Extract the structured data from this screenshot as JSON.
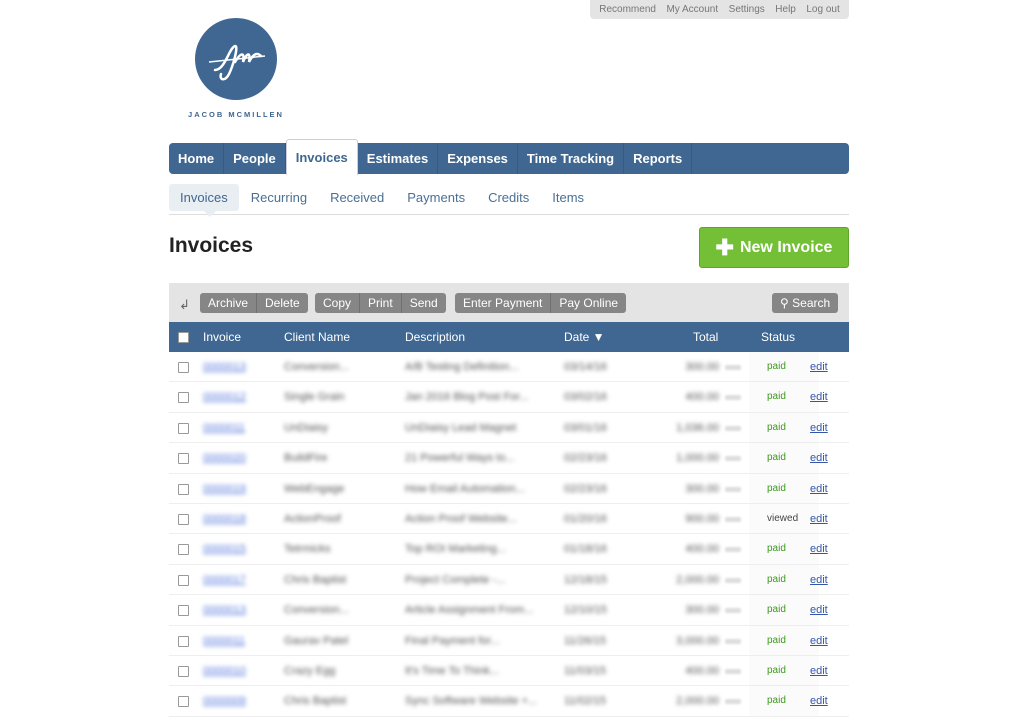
{
  "util_nav": [
    "Recommend",
    "My Account",
    "Settings",
    "Help",
    "Log out"
  ],
  "logo": {
    "name": "JACOB MCMILLEN",
    "mark": "jm"
  },
  "main_tabs": [
    "Home",
    "People",
    "Invoices",
    "Estimates",
    "Expenses",
    "Time Tracking",
    "Reports"
  ],
  "sub_tabs": [
    "Invoices",
    "Recurring",
    "Received",
    "Payments",
    "Credits",
    "Items"
  ],
  "page_title": "Invoices",
  "new_invoice_label": "New Invoice",
  "toolbar": {
    "group1": [
      "Archive",
      "Delete"
    ],
    "group2": [
      "Copy",
      "Print",
      "Send"
    ],
    "group3": [
      "Enter Payment",
      "Pay Online"
    ],
    "search": "Search"
  },
  "columns": {
    "invoice": "Invoice",
    "client": "Client Name",
    "description": "Description",
    "date": "Date ▼",
    "total": "Total",
    "status": "Status"
  },
  "rows": [
    {
      "invoice": "0000013",
      "client": "Conversion...",
      "description": "A/B Testing Definition...",
      "date": "03/14/16",
      "total": "300.00",
      "status": "paid",
      "action": "edit"
    },
    {
      "invoice": "0000012",
      "client": "Single Grain",
      "description": "Jan 2016 Blog Post For...",
      "date": "03/02/16",
      "total": "400.00",
      "status": "paid",
      "action": "edit"
    },
    {
      "invoice": "0000011",
      "client": "UnDiaisy",
      "description": "UnDiaisy Lead Magnet",
      "date": "03/01/16",
      "total": "1,036.00",
      "status": "paid",
      "action": "edit"
    },
    {
      "invoice": "0000020",
      "client": "BuildFire",
      "description": "21 Powerful Ways to...",
      "date": "02/23/16",
      "total": "1,000.00",
      "status": "paid",
      "action": "edit"
    },
    {
      "invoice": "0000019",
      "client": "WebEngage",
      "description": "How Email Automation...",
      "date": "02/23/16",
      "total": "300.00",
      "status": "paid",
      "action": "edit"
    },
    {
      "invoice": "0000018",
      "client": "ActionProof",
      "description": "Action Proof Website...",
      "date": "01/20/16",
      "total": "900.00",
      "status": "viewed",
      "action": "edit"
    },
    {
      "invoice": "0000015",
      "client": "Tetrmicks",
      "description": "Top ROI Marketing...",
      "date": "01/18/16",
      "total": "400.00",
      "status": "paid",
      "action": "edit"
    },
    {
      "invoice": "0000017",
      "client": "Chris Baptist",
      "description": "Project Complete -...",
      "date": "12/18/15",
      "total": "2,000.00",
      "status": "paid",
      "action": "edit"
    },
    {
      "invoice": "0000013",
      "client": "Conversion...",
      "description": "Article Assignment From...",
      "date": "12/10/15",
      "total": "300.00",
      "status": "paid",
      "action": "edit"
    },
    {
      "invoice": "0000011",
      "client": "Gaurav Patel",
      "description": "Final Payment for...",
      "date": "11/26/15",
      "total": "3,000.00",
      "status": "paid",
      "action": "edit"
    },
    {
      "invoice": "0000010",
      "client": "Crazy Egg",
      "description": "It's Time To Think...",
      "date": "11/03/15",
      "total": "400.00",
      "status": "paid",
      "action": "edit"
    },
    {
      "invoice": "0000009",
      "client": "Chris Baptist",
      "description": "Sync Software Website +...",
      "date": "11/02/15",
      "total": "2,000.00",
      "status": "paid",
      "action": "edit"
    }
  ]
}
